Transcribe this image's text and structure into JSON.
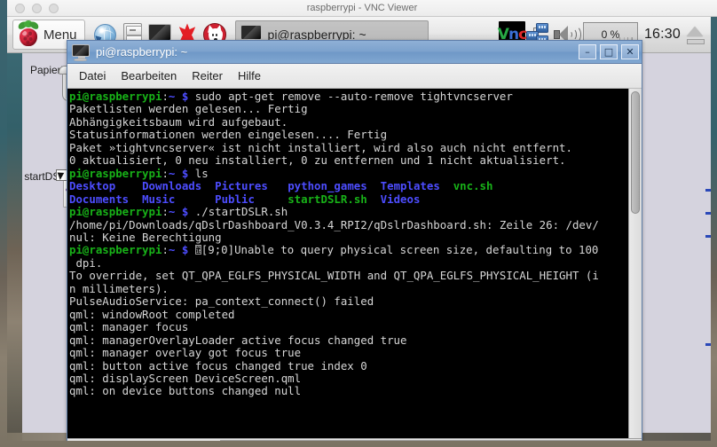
{
  "host_window": {
    "title": "raspberrypi - VNC Viewer",
    "traffic_lights": [
      "close",
      "minimize",
      "zoom"
    ]
  },
  "taskbar": {
    "menu_label": "Menu",
    "launchers": [
      {
        "name": "web-browser",
        "icon": "globe-icon"
      },
      {
        "name": "file-manager",
        "icon": "file-cabinet-icon"
      },
      {
        "name": "terminal",
        "icon": "monitor-icon"
      },
      {
        "name": "mathematica",
        "icon": "red-star-icon"
      },
      {
        "name": "wolfram",
        "icon": "fox-icon"
      }
    ],
    "task_button": {
      "label": "pi@raspberrypi: ~",
      "icon": "monitor-icon"
    },
    "tray": {
      "vnc_letters": [
        "V",
        "n",
        "c"
      ],
      "network_icon": "network-icon",
      "volume_icon": "speaker-icon",
      "cpu_label": "0 %",
      "clock": "16:30",
      "eject_icon": "eject-icon"
    }
  },
  "desktop_icons": [
    {
      "name": "trash",
      "label": "Papierkorb",
      "icon": "trash-icon"
    },
    {
      "name": "startdslr-script",
      "label": "startDSLR.sh",
      "icon": "script-file-icon"
    }
  ],
  "terminal": {
    "title": "pi@raspberrypi: ~",
    "window_controls": {
      "minimize": "–",
      "maximize": "□",
      "close": "✕"
    },
    "menus": [
      "Datei",
      "Bearbeiten",
      "Reiter",
      "Hilfe"
    ],
    "prompt": {
      "user_host": "pi@raspberrypi",
      "colon": ":",
      "path": "~",
      "dollar": "$"
    },
    "colors": {
      "background": "#000000",
      "foreground": "#d6d6d6",
      "green": "#18b218",
      "blue": "#4d4dff",
      "titlebar": "#7ca2cd"
    },
    "lines": [
      {
        "type": "command",
        "text": "sudo apt-get remove --auto-remove tightvncserver"
      },
      {
        "type": "output",
        "text": "Paketlisten werden gelesen... Fertig"
      },
      {
        "type": "output",
        "text": "Abhängigkeitsbaum wird aufgebaut."
      },
      {
        "type": "output",
        "text": "Statusinformationen werden eingelesen.... Fertig"
      },
      {
        "type": "output",
        "text": "Paket »tightvncserver« ist nicht installiert, wird also auch nicht entfernt."
      },
      {
        "type": "output",
        "text": "0 aktualisiert, 0 neu installiert, 0 zu entfernen und 1 nicht aktualisiert."
      },
      {
        "type": "command",
        "text": "ls"
      },
      {
        "type": "ls-row",
        "items": [
          {
            "text": "Desktop",
            "kind": "dir",
            "pad": 4
          },
          {
            "text": "Downloads",
            "kind": "dir",
            "pad": 2
          },
          {
            "text": "Pictures",
            "kind": "dir",
            "pad": 3
          },
          {
            "text": "python_games",
            "kind": "dir",
            "pad": 2
          },
          {
            "text": "Templates",
            "kind": "dir",
            "pad": 2
          },
          {
            "text": "vnc.sh",
            "kind": "exec",
            "pad": 0
          }
        ]
      },
      {
        "type": "ls-row",
        "items": [
          {
            "text": "Documents",
            "kind": "dir",
            "pad": 2
          },
          {
            "text": "Music",
            "kind": "dir",
            "pad": 6
          },
          {
            "text": "Public",
            "kind": "dir",
            "pad": 5
          },
          {
            "text": "startDSLR.sh",
            "kind": "exec",
            "pad": 2
          },
          {
            "text": "Videos",
            "kind": "dir",
            "pad": 0
          }
        ]
      },
      {
        "type": "command",
        "text": "./startDSLR.sh"
      },
      {
        "type": "output",
        "text": "/home/pi/Downloads/qDslrDashboard_V0.3.4_RPI2/qDslrDashboard.sh: Zeile 26: /dev/"
      },
      {
        "type": "output",
        "text": "nul: Keine Berechtigung"
      },
      {
        "type": "command-esc",
        "esc_top": "00",
        "esc_bottom": "1B",
        "text": "[9;0]Unable to query physical screen size, defaulting to 100"
      },
      {
        "type": "output",
        "text": " dpi."
      },
      {
        "type": "output",
        "text": "To override, set QT_QPA_EGLFS_PHYSICAL_WIDTH and QT_QPA_EGLFS_PHYSICAL_HEIGHT (i"
      },
      {
        "type": "output",
        "text": "n millimeters)."
      },
      {
        "type": "output",
        "text": "PulseAudioService: pa_context_connect() failed"
      },
      {
        "type": "output",
        "text": "qml: windowRoot completed"
      },
      {
        "type": "output",
        "text": "qml: manager focus"
      },
      {
        "type": "output",
        "text": "qml: managerOverlayLoader active focus changed true"
      },
      {
        "type": "output",
        "text": "qml: manager overlay got focus true"
      },
      {
        "type": "output",
        "text": "qml: button active focus changed true index 0"
      },
      {
        "type": "output",
        "text": "qml: displayScreen DeviceScreen.qml"
      },
      {
        "type": "output",
        "text": "qml: on device buttons changed null"
      }
    ]
  }
}
